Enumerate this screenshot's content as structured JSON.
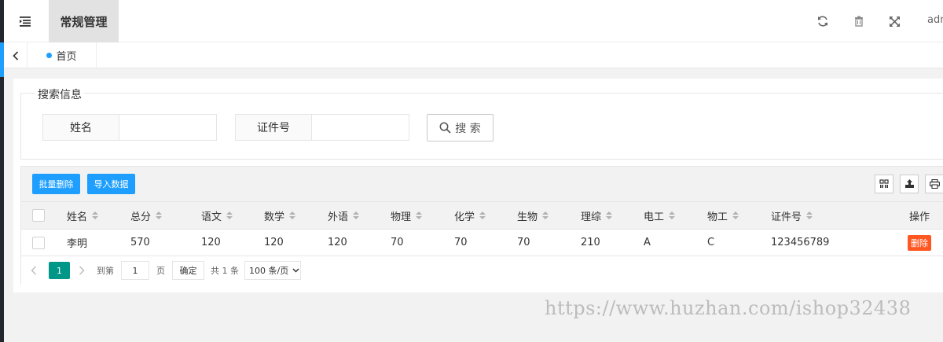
{
  "header": {
    "nav_tab": "常规管理",
    "user_name": "adm"
  },
  "tabbar": {
    "home_label": "首页"
  },
  "search": {
    "legend": "搜索信息",
    "name_label": "姓名",
    "name_value": "",
    "id_label": "证件号",
    "id_value": "",
    "button_label": "搜 索"
  },
  "toolbar": {
    "batch_delete": "批量删除",
    "import_data": "导入数据"
  },
  "table": {
    "columns": [
      "姓名",
      "总分",
      "语文",
      "数学",
      "外语",
      "物理",
      "化学",
      "生物",
      "理综",
      "电工",
      "物工",
      "证件号",
      "操作"
    ],
    "rows": [
      {
        "name": "李明",
        "total": "570",
        "chinese": "120",
        "math": "120",
        "foreign": "120",
        "physics": "70",
        "chemistry": "70",
        "biology": "70",
        "science": "210",
        "electric": "A",
        "physwork": "C",
        "id_no": "123456789",
        "action": "删除"
      }
    ]
  },
  "pager": {
    "current_page": "1",
    "goto_label": "到第",
    "goto_value": "1",
    "page_unit": "页",
    "confirm": "确定",
    "total_text": "共 1 条",
    "page_size": "100 条/页"
  },
  "watermark": "https://www.huzhan.com/ishop32438",
  "colors": {
    "primary": "#1e9fff",
    "danger": "#ff5722",
    "active_page": "#009688",
    "sidebar": "#23262e"
  }
}
